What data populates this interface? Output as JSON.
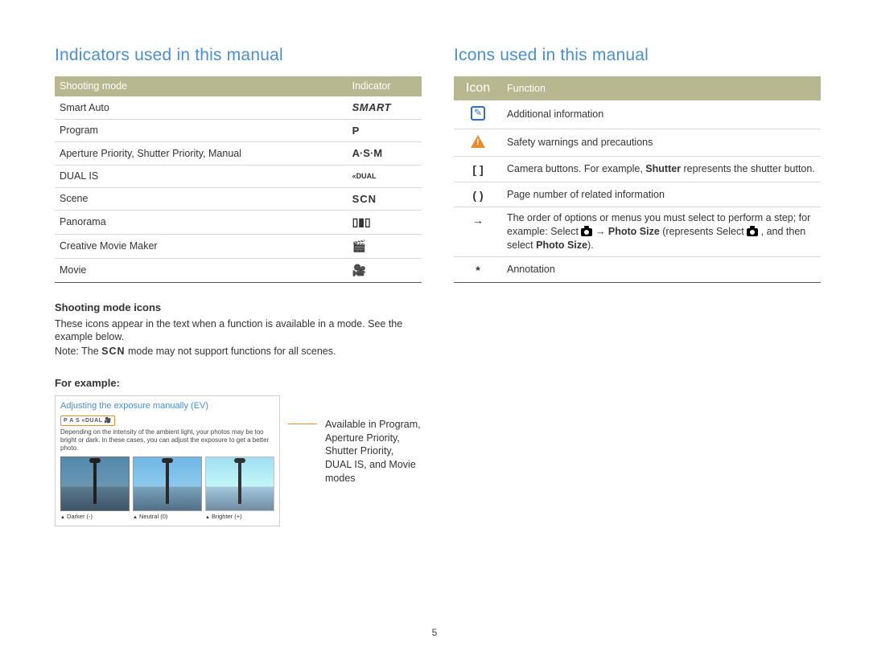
{
  "page_number": "5",
  "left": {
    "heading": "Indicators used in this manual",
    "table": {
      "headers": [
        "Shooting mode",
        "Indicator"
      ],
      "rows": [
        {
          "mode": "Smart Auto",
          "indicator": "SMART",
          "style": "smart"
        },
        {
          "mode": "Program",
          "indicator": "P",
          "style": "bold"
        },
        {
          "mode": "Aperture Priority, Shutter Priority, Manual",
          "indicator": "A·S·M",
          "style": "asm"
        },
        {
          "mode": "DUAL IS",
          "indicator": "«DUAL",
          "style": "small"
        },
        {
          "mode": "Scene",
          "indicator": "SCN",
          "style": "scn"
        },
        {
          "mode": "Panorama",
          "indicator": "▯▮▯",
          "style": "pano"
        },
        {
          "mode": "Creative Movie Maker",
          "indicator": "🎬",
          "style": "pano"
        },
        {
          "mode": "Movie",
          "indicator": "🎥",
          "style": "pano"
        }
      ]
    },
    "sub1": "Shooting mode icons",
    "para1": "These icons appear in the text when a function is available in a mode. See the example below.",
    "para2a": "Note: The ",
    "para2_inline": "SCN",
    "para2b": " mode may not support functions for all scenes.",
    "sub2": "For example:",
    "example": {
      "title": "Adjusting the exposure manually (EV)",
      "badge": "P A S «DUAL 🎥",
      "text": "Depending on the intensity of the ambient light, your photos may be too bright or dark. In these cases, you can adjust the exposure to get a better photo.",
      "thumbs": [
        "Darker (-)",
        "Neutral (0)",
        "Brighter (+)"
      ]
    },
    "example_side": "Available in Program, Aperture Priority, Shutter Priority, DUAL IS, and Movie modes"
  },
  "right": {
    "heading": "Icons used in this manual",
    "table": {
      "headers": [
        "Icon",
        "Function"
      ],
      "rows": [
        {
          "icon": "note",
          "symbol": "",
          "func": "Additional information"
        },
        {
          "icon": "warn",
          "symbol": "",
          "func": "Safety warnings and precautions"
        },
        {
          "icon": "text",
          "symbol": "[  ]",
          "func_pre": "Camera buttons. For example, ",
          "func_bold": "Shutter",
          "func_post": " represents the shutter button."
        },
        {
          "icon": "text",
          "symbol": "(  )",
          "func": "Page number of related information"
        },
        {
          "icon": "arrow",
          "symbol": "→",
          "func_pre": "The order of options or menus you must select to perform a step; for example: Select ",
          "func_mid": " → ",
          "func_bold": "Photo Size",
          "func_post2a": " (represents Select ",
          "func_post2b": " , and then select ",
          "func_bold2": "Photo Size",
          "func_post2c": ")."
        },
        {
          "icon": "text",
          "symbol": "*",
          "func": "Annotation"
        }
      ]
    }
  }
}
